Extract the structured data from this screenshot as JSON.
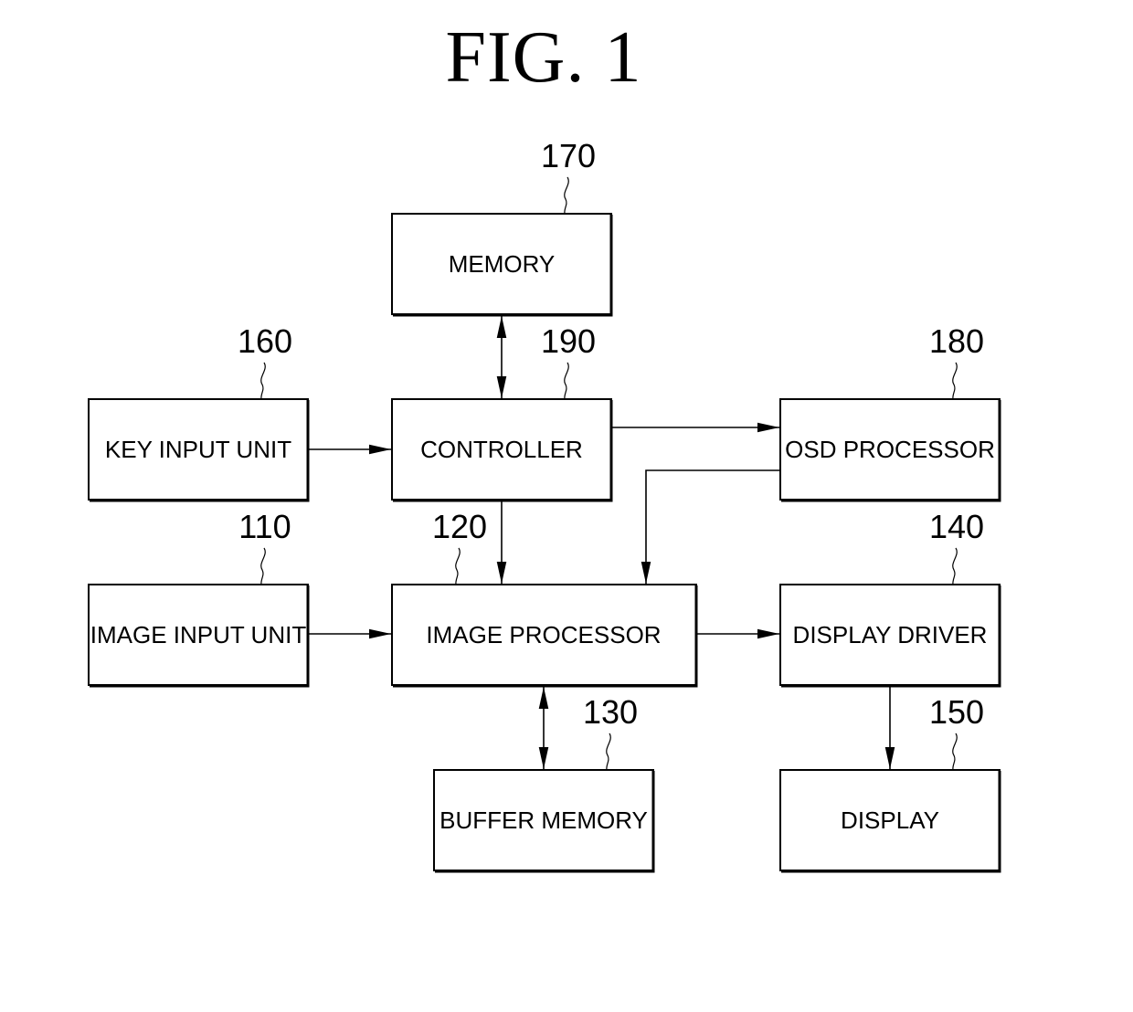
{
  "figure": {
    "title": "FIG. 1"
  },
  "blocks": {
    "memory": {
      "label": "MEMORY",
      "ref": "170"
    },
    "controller": {
      "label": "CONTROLLER",
      "ref": "190"
    },
    "key_input_unit": {
      "label": "KEY INPUT UNIT",
      "ref": "160"
    },
    "osd_processor": {
      "label": "OSD PROCESSOR",
      "ref": "180"
    },
    "image_input_unit": {
      "label": "IMAGE INPUT UNIT",
      "ref": "110"
    },
    "image_processor": {
      "label": "IMAGE PROCESSOR",
      "ref": "120"
    },
    "display_driver": {
      "label": "DISPLAY DRIVER",
      "ref": "140"
    },
    "buffer_memory": {
      "label": "BUFFER MEMORY",
      "ref": "130"
    },
    "display": {
      "label": "DISPLAY",
      "ref": "150"
    }
  },
  "connections": [
    {
      "from": "memory",
      "to": "controller",
      "direction": "bidirectional"
    },
    {
      "from": "key_input_unit",
      "to": "controller",
      "direction": "forward"
    },
    {
      "from": "controller",
      "to": "osd_processor",
      "direction": "forward"
    },
    {
      "from": "osd_processor",
      "to": "image_processor",
      "direction": "forward"
    },
    {
      "from": "controller",
      "to": "image_processor",
      "direction": "forward"
    },
    {
      "from": "image_input_unit",
      "to": "image_processor",
      "direction": "forward"
    },
    {
      "from": "image_processor",
      "to": "display_driver",
      "direction": "forward"
    },
    {
      "from": "image_processor",
      "to": "buffer_memory",
      "direction": "bidirectional"
    },
    {
      "from": "display_driver",
      "to": "display",
      "direction": "forward"
    }
  ]
}
